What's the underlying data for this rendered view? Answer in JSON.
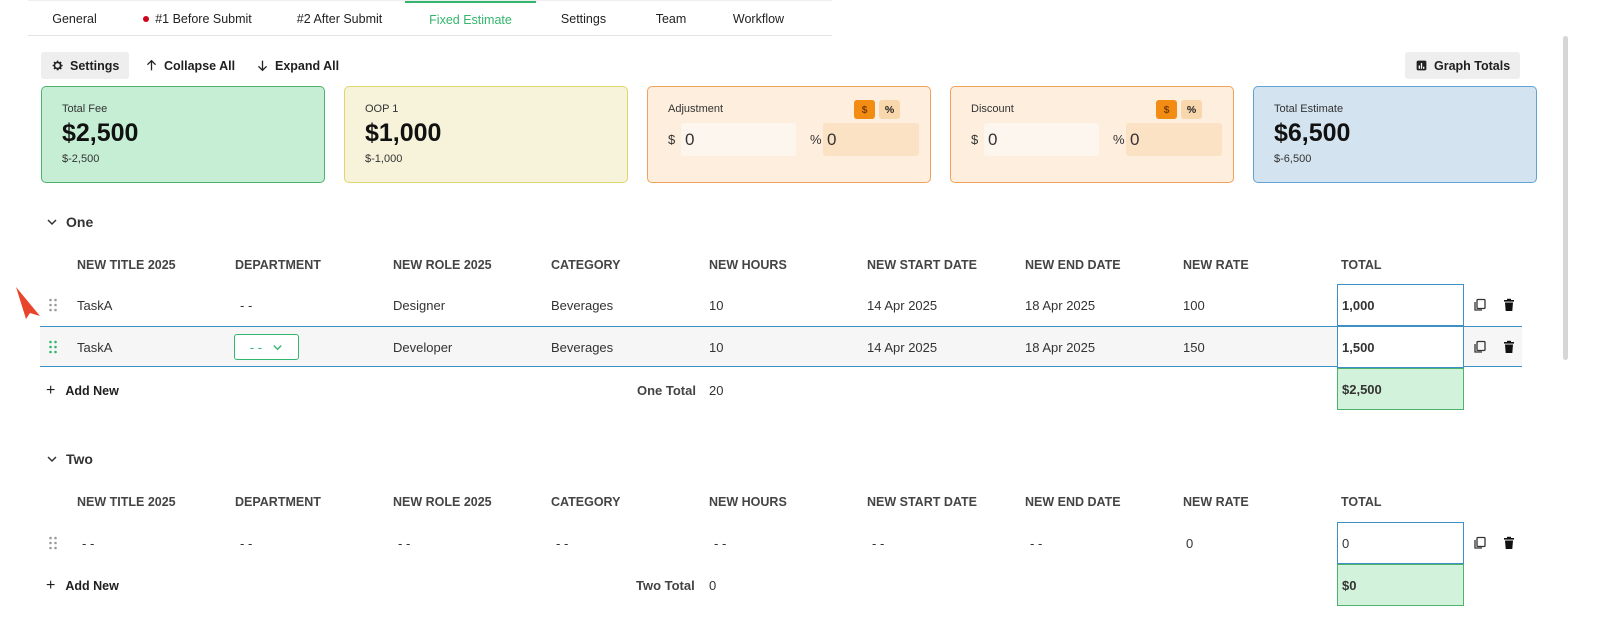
{
  "tabs": [
    {
      "label": "General",
      "active": false,
      "alert": false
    },
    {
      "label": "#1 Before Submit",
      "active": false,
      "alert": true
    },
    {
      "label": "#2 After Submit",
      "active": false,
      "alert": false
    },
    {
      "label": "Fixed Estimate",
      "active": true,
      "alert": false
    },
    {
      "label": "Settings",
      "active": false,
      "alert": false
    },
    {
      "label": "Team",
      "active": false,
      "alert": false
    },
    {
      "label": "Workflow",
      "active": false,
      "alert": false
    }
  ],
  "toolbar": {
    "settings_label": "Settings",
    "collapse_label": "Collapse All",
    "expand_label": "Expand All",
    "graph_label": "Graph Totals"
  },
  "cards": {
    "total_fee": {
      "label": "Total Fee",
      "value": "$2,500",
      "sub": "$-2,500"
    },
    "oop1": {
      "label": "OOP 1",
      "value": "$1,000",
      "sub": "$-1,000"
    },
    "adjustment": {
      "label": "Adjustment",
      "toggle_dollar": "$",
      "toggle_pct": "%",
      "dollar_symbol": "$",
      "dollar_value": "0",
      "pct_symbol": "%",
      "pct_value": "0"
    },
    "discount": {
      "label": "Discount",
      "toggle_dollar": "$",
      "toggle_pct": "%",
      "dollar_symbol": "$",
      "dollar_value": "0",
      "pct_symbol": "%",
      "pct_value": "0"
    },
    "total_estimate": {
      "label": "Total Estimate",
      "value": "$6,500",
      "sub": "$-6,500"
    }
  },
  "columns": [
    "NEW TITLE 2025",
    "DEPARTMENT",
    "NEW ROLE 2025",
    "CATEGORY",
    "NEW HOURS",
    "NEW START DATE",
    "NEW END DATE",
    "NEW RATE",
    "TOTAL"
  ],
  "sections": [
    {
      "name": "One",
      "rows": [
        {
          "title": "TaskA",
          "department": "- -",
          "role": "Designer",
          "category": "Beverages",
          "hours": "10",
          "start": "14 Apr 2025",
          "end": "18 Apr 2025",
          "rate": "100",
          "total": "1,000"
        },
        {
          "title": "TaskA",
          "department": "- -",
          "role": "Developer",
          "category": "Beverages",
          "hours": "10",
          "start": "14 Apr 2025",
          "end": "18 Apr 2025",
          "rate": "150",
          "total": "1,500"
        }
      ],
      "add_label": "Add New",
      "total_label": "One Total",
      "hours_total": "20",
      "sum_total": "$2,500"
    },
    {
      "name": "Two",
      "rows": [
        {
          "title": "- -",
          "department": "- -",
          "role": "- -",
          "category": "- -",
          "hours": "- -",
          "start": "- -",
          "end": "- -",
          "rate": "0",
          "total": "0"
        }
      ],
      "add_label": "Add New",
      "total_label": "Two Total",
      "hours_total": "0",
      "sum_total": "$0"
    }
  ],
  "colors": {
    "accent": "#33b56d",
    "alert": "#d0021b",
    "selection": "#3d8fc6",
    "annotation_arrow": "#e8452c"
  }
}
